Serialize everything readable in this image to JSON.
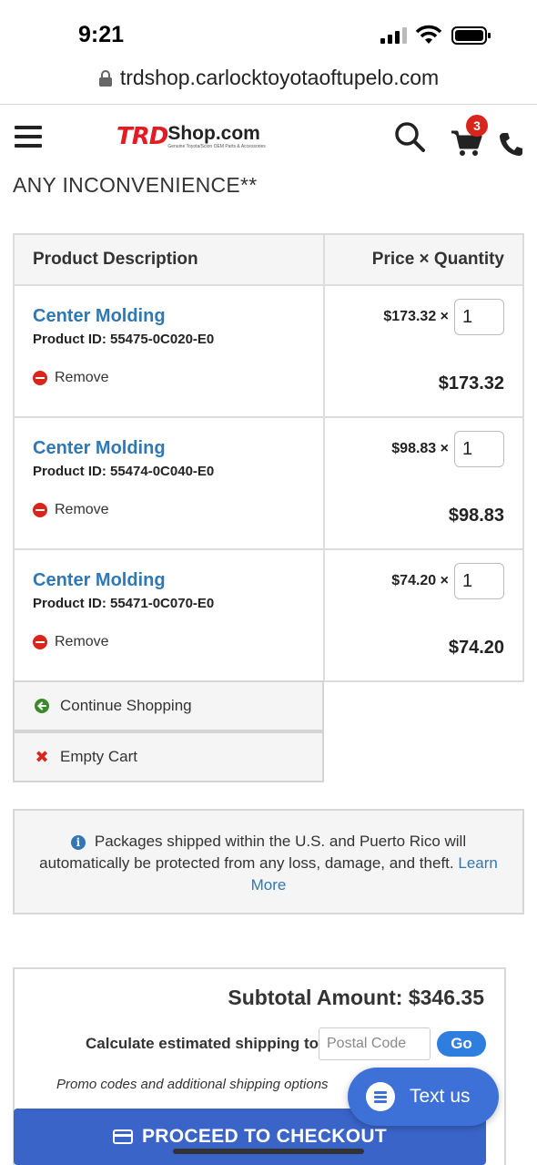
{
  "status_bar": {
    "time": "9:21"
  },
  "browser": {
    "url": "trdshop.carlocktoyotaoftupelo.com"
  },
  "header": {
    "logo_trd": "TRD",
    "logo_shop": "Shop.com",
    "logo_tagline": "Genuine Toyota/Scion OEM Parts & Accessories",
    "cart_count": "3"
  },
  "notice": {
    "text": "ANY INCONVENIENCE**"
  },
  "cart": {
    "col_description": "Product Description",
    "col_price_qty": "Price × Quantity",
    "items": [
      {
        "title": "Center Molding",
        "product_id": "Product ID: 55475-0C020-E0",
        "remove": "Remove",
        "unit_price": "$173.32 ×",
        "qty": "1",
        "total": "$173.32"
      },
      {
        "title": "Center Molding",
        "product_id": "Product ID: 55474-0C040-E0",
        "remove": "Remove",
        "unit_price": "$98.83 ×",
        "qty": "1",
        "total": "$98.83"
      },
      {
        "title": "Center Molding",
        "product_id": "Product ID: 55471-0C070-E0",
        "remove": "Remove",
        "unit_price": "$74.20 ×",
        "qty": "1",
        "total": "$74.20"
      }
    ]
  },
  "actions": {
    "continue": "Continue Shopping",
    "empty": "Empty Cart"
  },
  "info": {
    "text": "Packages shipped within the U.S. and Puerto Rico will automatically be protected from any loss, damage, and theft.",
    "link": "Learn More"
  },
  "summary": {
    "subtotal": "Subtotal Amount: $346.35",
    "shipping_label": "Calculate estimated shipping to",
    "postal_placeholder": "Postal Code",
    "go": "Go",
    "promo": "Promo codes and additional shipping options"
  },
  "checkout": {
    "label": "PROCEED TO CHECKOUT"
  },
  "chat": {
    "label": "Text us"
  },
  "colors": {
    "link_blue": "#2f78b5",
    "brand_red": "#e31b23",
    "checkout_blue": "#3a64c8",
    "chat_blue": "#3e71d8"
  }
}
